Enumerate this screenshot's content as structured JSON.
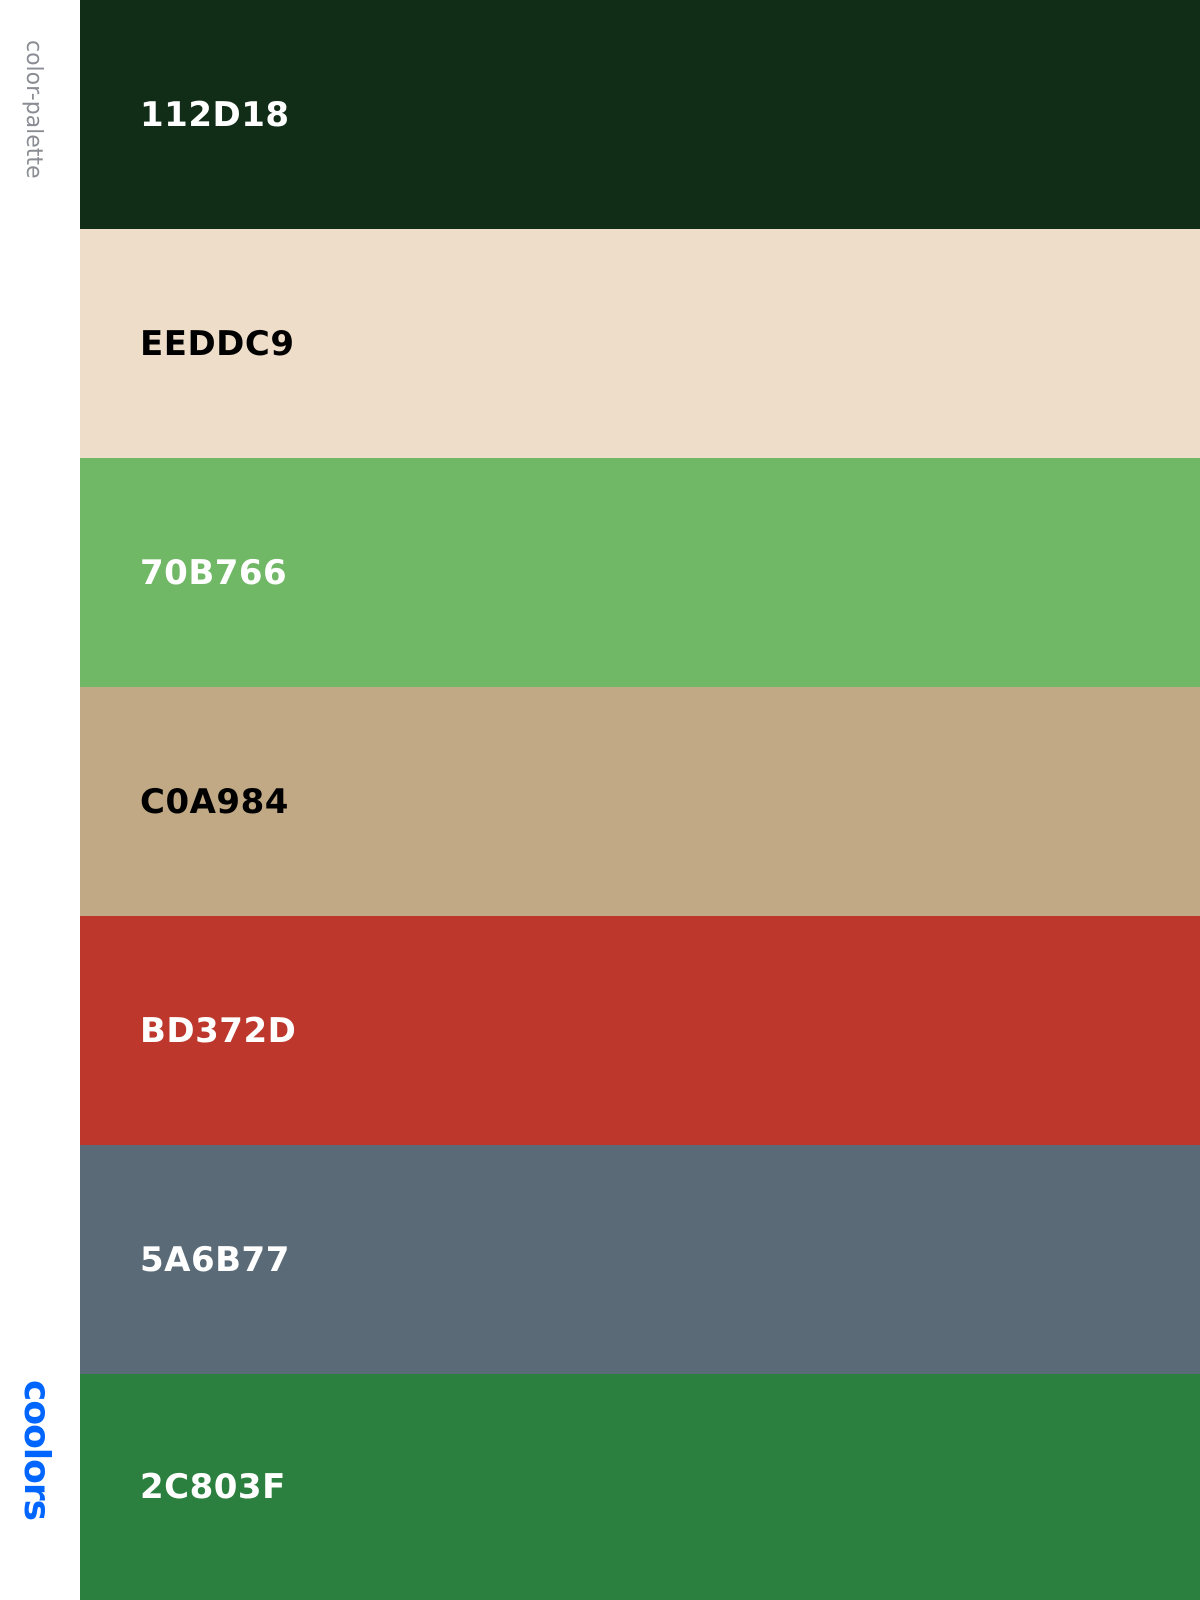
{
  "sidebar": {
    "title": "color-palette",
    "brand": "coolors",
    "brand_color": "#0066FF"
  },
  "palette": [
    {
      "hex": "112D18",
      "color": "#112D18",
      "text_color": "#FFFFFF"
    },
    {
      "hex": "EEDDC9",
      "color": "#EEDDC9",
      "text_color": "#000000"
    },
    {
      "hex": "70B766",
      "color": "#70B766",
      "text_color": "#FFFFFF"
    },
    {
      "hex": "C0A984",
      "color": "#C0A984",
      "text_color": "#000000"
    },
    {
      "hex": "BD372D",
      "color": "#BD372D",
      "text_color": "#FFFFFF"
    },
    {
      "hex": "5A6B77",
      "color": "#5A6B77",
      "text_color": "#FFFFFF"
    },
    {
      "hex": "2C803F",
      "color": "#2C803F",
      "text_color": "#FFFFFF"
    }
  ]
}
